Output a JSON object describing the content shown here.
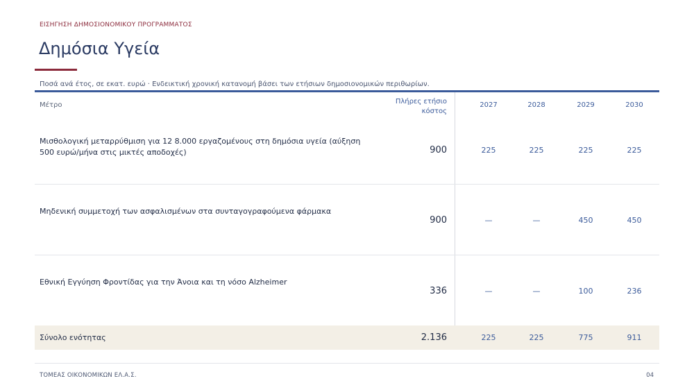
{
  "header": {
    "kicker": "ΕΙΣΗΓΗΣΗ ΔΗΜΟΣΙΟΝΟΜΙΚΟΥ ΠΡΟΓΡΑΜΜΑΤΟΣ",
    "title": "Δημόσια Υγεία",
    "subtitle": "Ποσά ανά έτος, σε εκατ. ευρώ · Ενδεικτική χρονική κατανομή βάσει των ετήσιων δημοσιονομικών περιθωρίων."
  },
  "table": {
    "columns": {
      "measure": "Μέτρο",
      "cost": "Πλήρες ετήσιο κόστος",
      "years": [
        "2027",
        "2028",
        "2029",
        "2030"
      ]
    },
    "rows": [
      {
        "measure": "Μισθολογική  μεταρρύθμιση για 12 8.000 εργαζομένους στη δημόσια υγεία (αύξηση 500 ευρώ/μήνα στις μικτές αποδοχές)",
        "cost": "900",
        "values": [
          "225",
          "225",
          "225",
          "225"
        ]
      },
      {
        "measure": "Μηδενική συμμετοχή των ασφαλισμένων στα συνταγογραφούμενα φάρμακα",
        "cost": "900",
        "values": [
          "—",
          "—",
          "450",
          "450"
        ]
      },
      {
        "measure": "Εθνική Εγγύηση Φροντίδας για την Άνοια και τη νόσο Alzheimer",
        "cost": "336",
        "values": [
          "—",
          "—",
          "100",
          "236"
        ]
      }
    ],
    "total": {
      "label": "Σύνολο ενότητας",
      "cost": "2.136",
      "values": [
        "225",
        "225",
        "775",
        "911"
      ]
    }
  },
  "footer": {
    "left": "ΤΟΜΕΑΣ ΟΙΚΟΝΟΜΙΚΩΝ ΕΛ.Α.Σ.",
    "page": "04"
  },
  "colors": {
    "accent": "#8b2a3b",
    "rule": "#3a5a9a",
    "total_band": "#f3efe6"
  }
}
